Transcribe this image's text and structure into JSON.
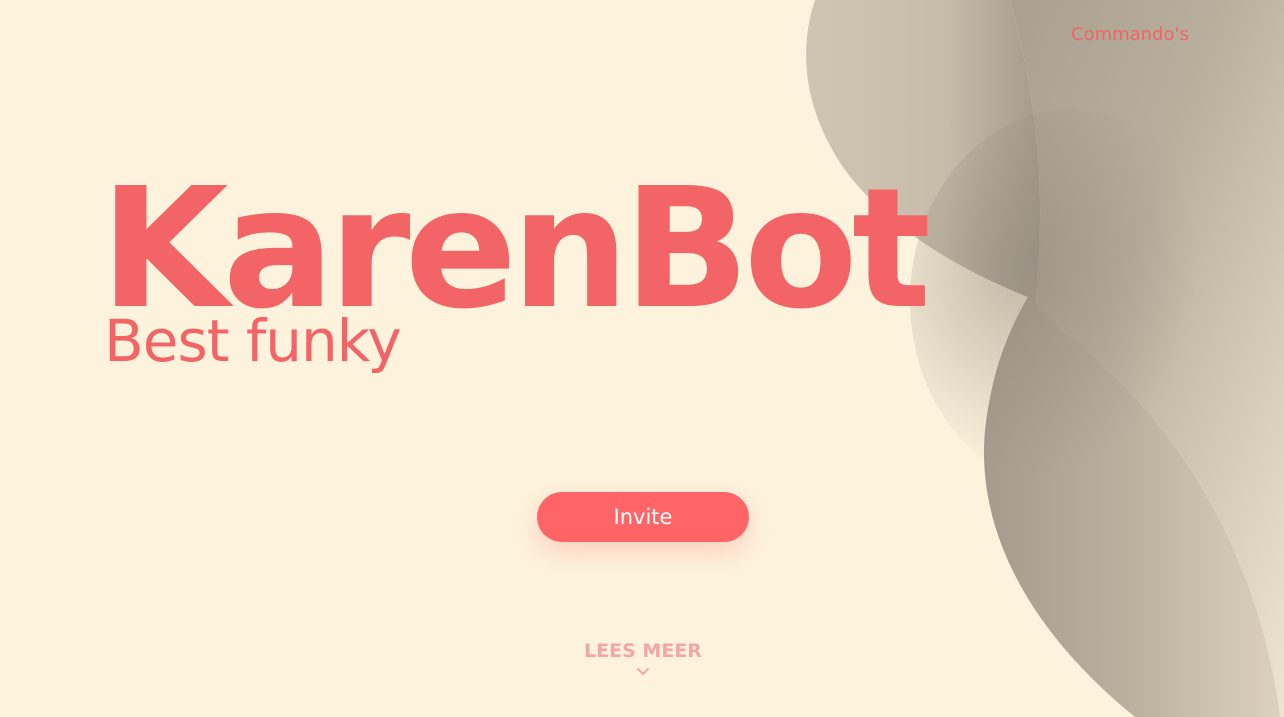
{
  "nav": {
    "commands_label": "Commando's"
  },
  "hero": {
    "title": "KarenBot",
    "subtitle": "Best funky"
  },
  "actions": {
    "invite_label": "Invite",
    "read_more_label": "LEES MEER"
  },
  "icons": {
    "read_more": "chevron-down-icon"
  },
  "colors": {
    "background": "#fdf3dd",
    "accent": "#ff6566",
    "wave": "#b8ad9c"
  }
}
